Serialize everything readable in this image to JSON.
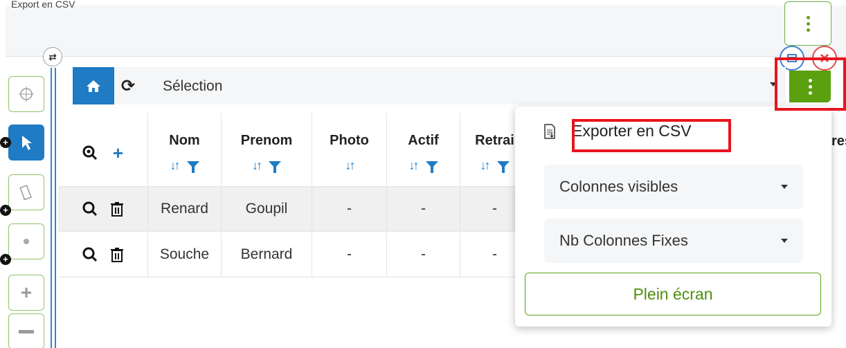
{
  "top": {
    "caption": "Export en CSV"
  },
  "toolbar": {
    "title": "Sélection"
  },
  "grid": {
    "columns": [
      {
        "label": "Nom",
        "sort": true,
        "filter": true
      },
      {
        "label": "Prenom",
        "sort": true,
        "filter": true
      },
      {
        "label": "Photo",
        "sort": true,
        "filter": false
      },
      {
        "label": "Actif",
        "sort": true,
        "filter": true
      },
      {
        "label": "Retrai",
        "sort": true,
        "filter": true
      }
    ],
    "rows": [
      {
        "nom": "Renard",
        "prenom": "Goupil",
        "photo": "-",
        "actif": "-",
        "retrait": "-"
      },
      {
        "nom": "Souche",
        "prenom": "Bernard",
        "photo": "-",
        "actif": "-",
        "retrait": "-"
      }
    ],
    "cut_header": "res"
  },
  "menu": {
    "export_label": "Exporter en CSV",
    "visible_columns_label": "Colonnes visibles",
    "fixed_columns_label": "Nb Colonnes Fixes",
    "fullscreen_label": "Plein écran"
  },
  "colors": {
    "primary_blue": "#1e7bc4",
    "accent_green": "#5aa00f",
    "highlight_red": "#e8141e"
  },
  "icons": [
    "ellipsis-vertical-icon",
    "home-icon",
    "refresh-icon",
    "zoom-icon",
    "plus-icon",
    "search-icon",
    "trash-icon",
    "csv-file-icon",
    "caret-down-icon",
    "swap-icon",
    "target-icon",
    "cursor-icon"
  ]
}
